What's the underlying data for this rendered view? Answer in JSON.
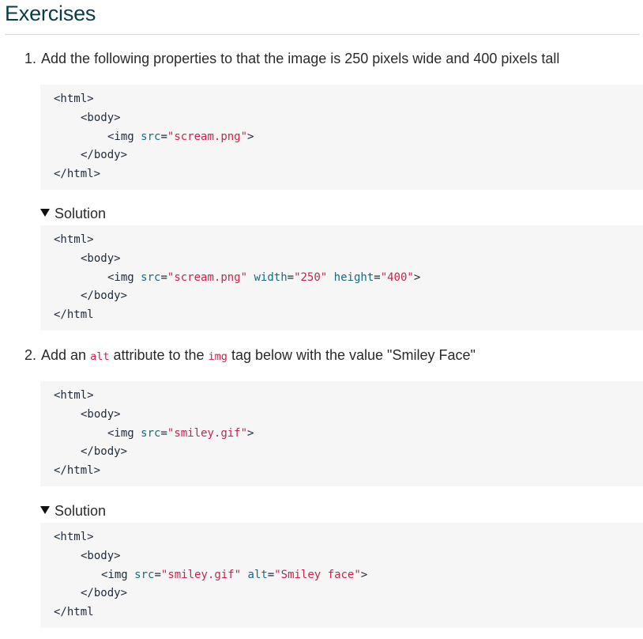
{
  "heading": "Exercises",
  "exercise1": {
    "number": "1.",
    "text": "Add the following properties to that the image is 250 pixels wide and 400 pixels tall",
    "code": {
      "l1": "<html>",
      "l2": "<body>",
      "l3_open": "<img ",
      "l3_attr": "src",
      "l3_eq": "=",
      "l3_val": "\"scream.png\"",
      "l3_close": ">",
      "l4": "</body>",
      "l5": "</html>"
    },
    "solution_label": "Solution",
    "solution_code": {
      "l1": "<html>",
      "l2": "<body>",
      "l3_open": "<img ",
      "l3_attr1": "src",
      "l3_eq1": "=",
      "l3_val1": "\"scream.png\"",
      "l3_attr2": "width",
      "l3_eq2": "=",
      "l3_val2": "\"250\"",
      "l3_attr3": "height",
      "l3_eq3": "=",
      "l3_val3": "\"400\"",
      "l3_close": ">",
      "l4": "</body>",
      "l5": "</html"
    }
  },
  "exercise2": {
    "number": "2.",
    "text_before": "Add an ",
    "code_alt": "alt",
    "text_mid": " attribute to the ",
    "code_img": "img",
    "text_after": " tag below with the value \"Smiley Face\"",
    "code": {
      "l1": "<html>",
      "l2": "<body>",
      "l3_open": "<img ",
      "l3_attr": "src",
      "l3_eq": "=",
      "l3_val": "\"smiley.gif\"",
      "l3_close": ">",
      "l4": "</body>",
      "l5": "</html>"
    },
    "solution_label": "Solution",
    "solution_code": {
      "l1": "<html>",
      "l2": "<body>",
      "l3_open": "<img ",
      "l3_attr1": "src",
      "l3_eq1": "=",
      "l3_val1": "\"smiley.gif\"",
      "l3_attr2": "alt",
      "l3_eq2": "=",
      "l3_val2": "\"Smiley face\"",
      "l3_close": ">",
      "l4": "</body>",
      "l5": "</html"
    }
  }
}
